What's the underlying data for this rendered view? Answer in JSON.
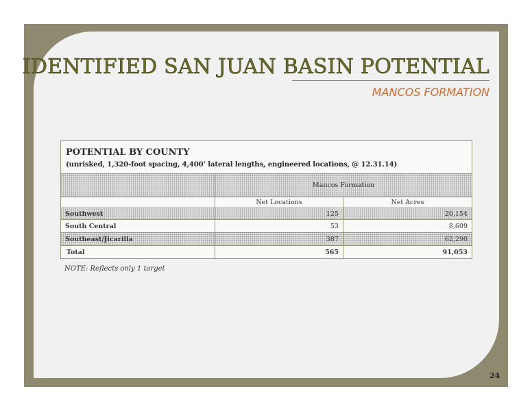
{
  "slide": {
    "title": "IDENTIFIED SAN JUAN BASIN POTENTIAL",
    "subtitle": "MANCOS FORMATION",
    "page_number": "24",
    "note": "NOTE: Reflects only 1 target"
  },
  "table": {
    "heading": "POTENTIAL BY COUNTY",
    "subheading": "(unrisked, 1,320-foot spacing, 4,400’ lateral lengths, engineered locations, @ 12.31.14)",
    "group_header": "Mancos Formation",
    "columns": [
      "Net Locations",
      "Net Acres"
    ],
    "rows": [
      {
        "label": "Southwest",
        "net_locations": "125",
        "net_acres": "20,154"
      },
      {
        "label": "South Central",
        "net_locations": "53",
        "net_acres": "8,609"
      },
      {
        "label": "Southeast/Jicarilla",
        "net_locations": "387",
        "net_acres": "62,290"
      }
    ],
    "total": {
      "label": "Total",
      "net_locations": "565",
      "net_acres": "91,053"
    }
  }
}
